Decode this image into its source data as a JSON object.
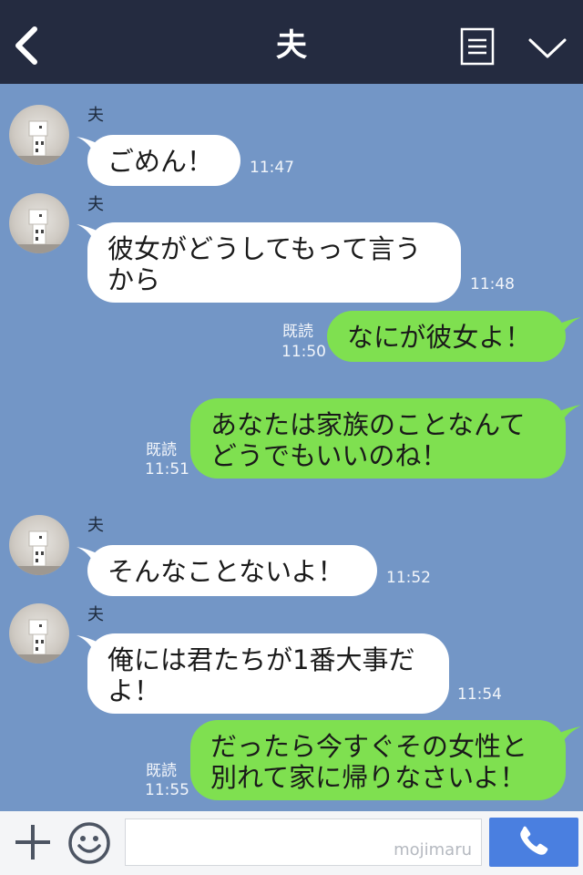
{
  "header": {
    "title": "夫",
    "back_icon": "chevron-left-icon",
    "menu_icon": "menu-icon",
    "collapse_icon": "chevron-down-icon"
  },
  "colors": {
    "header_bg": "#242b40",
    "chat_bg": "#7396c6",
    "bubble_incoming": "#ffffff",
    "bubble_outgoing": "#7fe050",
    "send_button": "#4a7fe0"
  },
  "messages": [
    {
      "direction": "in",
      "sender": "夫",
      "lines": [
        "ごめん！"
      ],
      "time": "11:47"
    },
    {
      "direction": "in",
      "sender": "夫",
      "lines": [
        "彼女がどうしてもって言う",
        "から"
      ],
      "time": "11:48"
    },
    {
      "direction": "out",
      "read": "既読",
      "lines": [
        "なにが彼女よ！"
      ],
      "time": "11:50"
    },
    {
      "direction": "out",
      "read": "既読",
      "lines": [
        "あなたは家族のことなんて",
        "どうでもいいのね！"
      ],
      "time": "11:51"
    },
    {
      "direction": "in",
      "sender": "夫",
      "lines": [
        "そんなことないよ！"
      ],
      "time": "11:52"
    },
    {
      "direction": "in",
      "sender": "夫",
      "lines": [
        "俺には君たちが1番大事だ",
        "よ！"
      ],
      "time": "11:54"
    },
    {
      "direction": "out",
      "read": "既読",
      "lines": [
        "だったら今すぐその女性と",
        "別れて家に帰りなさいよ！"
      ],
      "time": "11:55"
    }
  ],
  "footer": {
    "plus_icon": "plus-icon",
    "emoji_icon": "smiley-icon",
    "input_value": "",
    "watermark": "mojimaru",
    "call_icon": "phone-icon"
  }
}
